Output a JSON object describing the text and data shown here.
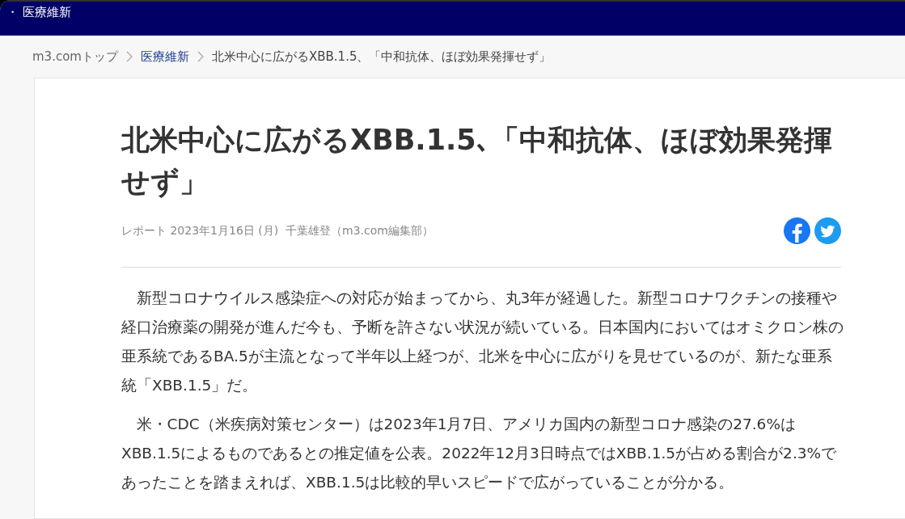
{
  "window": {
    "title": "・ 医療維新"
  },
  "breadcrumb": [
    {
      "label": "m3.comトップ",
      "kind": "link"
    },
    {
      "label": "医療維新",
      "kind": "section"
    },
    {
      "label": "北米中心に広がるXBB.1.5、「中和抗体、ほぼ効果発揮せず」",
      "kind": "current"
    }
  ],
  "article": {
    "title": "北米中心に広がるXBB.1.5､「中和抗体、ほぼ効果発揮せず」",
    "meta": "レポート 2023年1月16日 (月)  千葉雄登（m3.com編集部）",
    "share": [
      {
        "kind": "facebook",
        "color": "#1877f2"
      },
      {
        "kind": "twitter",
        "color": "#1d9bf0"
      }
    ],
    "paragraphs": [
      "新型コロナウイルス感染症への対応が始まってから、丸3年が経過した。新型コロナワクチンの接種や経口治療薬の開発が進んだ今も、予断を許さない状況が続いている。日本国内においてはオミクロン株の亜系統であるBA.5が主流となって半年以上経つが、北米を中心に広がりを見せているのが、新たな亜系統「XBB.1.5」だ。",
      "米・CDC（米疾病対策センター）は2023年1月7日、アメリカ国内の新型コロナ感染の27.6%はXBB.1.5によるものであるとの推定値を公表。2022年12月3日時点ではXBB.1.5が占める割合が2.3%であったことを踏まえれば、XBB.1.5は比較的早いスピードで広がっていることが分かる。"
    ]
  }
}
